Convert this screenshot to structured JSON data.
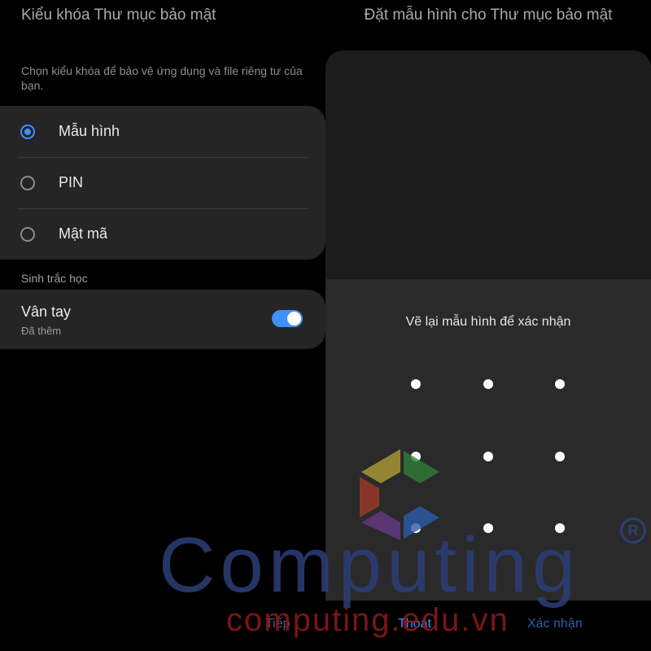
{
  "left": {
    "title": "Kiểu khóa Thư mục bảo mật",
    "description": "Chọn kiểu khóa để bảo vệ ứng dụng và file riêng tư của bạn.",
    "lock_options": [
      {
        "label": "Mẫu hình",
        "selected": true
      },
      {
        "label": "PIN",
        "selected": false
      },
      {
        "label": "Mật mã",
        "selected": false
      }
    ],
    "biometrics_section": "Sinh trắc học",
    "fingerprint": {
      "title": "Vân tay",
      "status": "Đã thêm",
      "enabled": true
    }
  },
  "right": {
    "title": "Đặt mẫu hình cho Thư mục bảo mật",
    "confirm_prompt": "Vẽ lại mẫu hình để xác nhận",
    "pattern_grid": {
      "rows": 3,
      "cols": 3
    }
  },
  "footer": {
    "next_label": "Tiếp",
    "exit_label": "Thoát",
    "confirm_label": "Xác nhận"
  },
  "watermark": {
    "brand": "Computing",
    "registered": "R",
    "domain": "computing.edu.vn"
  },
  "colors": {
    "accent": "#3e91ff",
    "card": "#252525",
    "background": "#000000"
  }
}
